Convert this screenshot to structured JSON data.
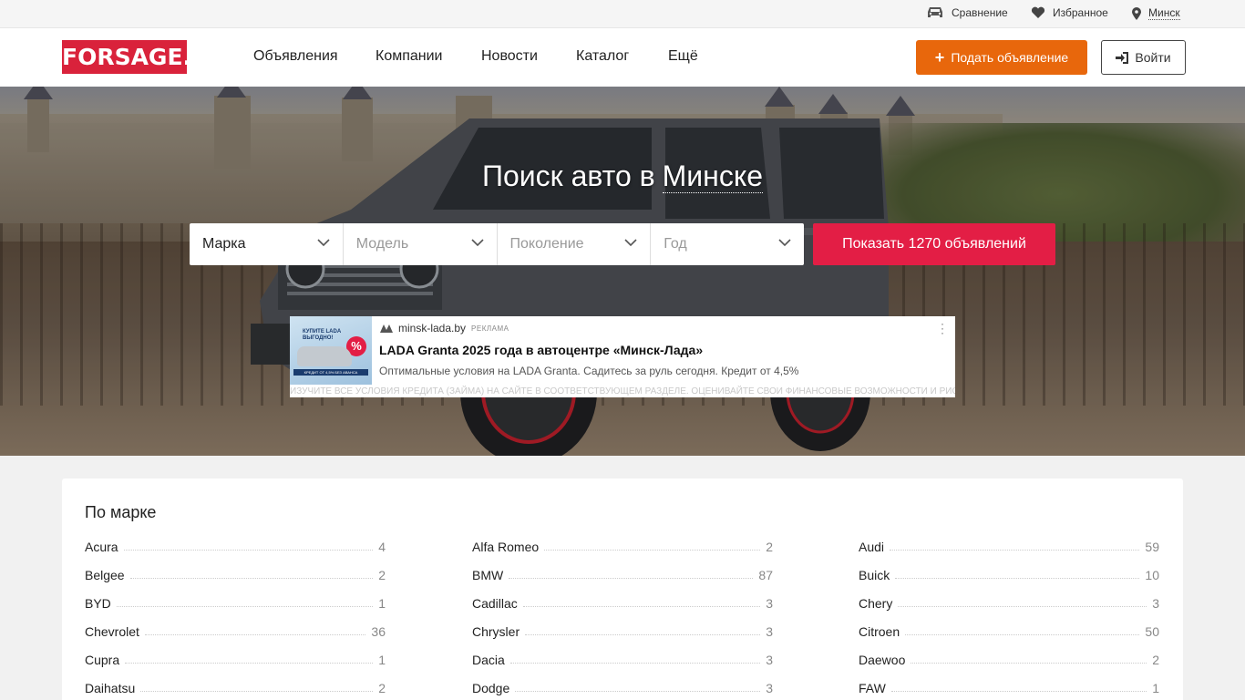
{
  "topbar": {
    "compare_label": "Сравнение",
    "favorites_label": "Избранное",
    "city_label": "Минск"
  },
  "header": {
    "logo_text": "FORSAGE.BY",
    "nav": [
      {
        "label": "Объявления"
      },
      {
        "label": "Компании"
      },
      {
        "label": "Новости"
      },
      {
        "label": "Каталог"
      },
      {
        "label": "Ещё"
      }
    ],
    "post_button": "Подать объявление",
    "login_button": "Войти",
    "accent_color": "#d9223b",
    "post_color": "#e8670c"
  },
  "hero": {
    "title_prefix": "Поиск авто в",
    "title_city": "Минске",
    "selects": [
      {
        "value": "Марка",
        "placeholder": false
      },
      {
        "value": "Модель",
        "placeholder": true
      },
      {
        "value": "Поколение",
        "placeholder": true
      },
      {
        "value": "Год",
        "placeholder": true
      }
    ],
    "show_button": "Показать 1270 объявлений",
    "show_color": "#e31e45"
  },
  "ad": {
    "thumb_headline": "КУПИТЕ LADA ВЫГОДНО!",
    "thumb_badge": "%",
    "thumb_strip": "КРЕДИТ ОТ 4,5% БЕЗ АВАНСА",
    "source": "minsk-lada.by",
    "tag": "РЕКЛАМА",
    "title": "LADA Granta 2025 года в автоцентре «Минск-Лада»",
    "description": "Оптимальные условия на LADA Granta. Садитесь за руль сегодня. Кредит от 4,5%",
    "disclaimer": "ИЗУЧИТЕ ВСЕ УСЛОВИЯ КРЕДИТА (ЗАЙМА) НА САЙТЕ В СООТВЕТСТВУЮЩЕМ РАЗДЕЛЕ. ОЦЕНИВАЙТЕ СВОИ ФИНАНСОВЫЕ ВОЗМОЖНОСТИ И РИСКИ"
  },
  "brands": {
    "heading": "По марке",
    "columns": [
      [
        {
          "name": "Acura",
          "count": "4"
        },
        {
          "name": "Belgee",
          "count": "2"
        },
        {
          "name": "BYD",
          "count": "1"
        },
        {
          "name": "Chevrolet",
          "count": "36"
        },
        {
          "name": "Cupra",
          "count": "1"
        },
        {
          "name": "Daihatsu",
          "count": "2"
        }
      ],
      [
        {
          "name": "Alfa Romeo",
          "count": "2"
        },
        {
          "name": "BMW",
          "count": "87"
        },
        {
          "name": "Cadillac",
          "count": "3"
        },
        {
          "name": "Chrysler",
          "count": "3"
        },
        {
          "name": "Dacia",
          "count": "3"
        },
        {
          "name": "Dodge",
          "count": "3"
        }
      ],
      [
        {
          "name": "Audi",
          "count": "59"
        },
        {
          "name": "Buick",
          "count": "10"
        },
        {
          "name": "Chery",
          "count": "3"
        },
        {
          "name": "Citroen",
          "count": "50"
        },
        {
          "name": "Daewoo",
          "count": "2"
        },
        {
          "name": "FAW",
          "count": "1"
        }
      ]
    ]
  }
}
